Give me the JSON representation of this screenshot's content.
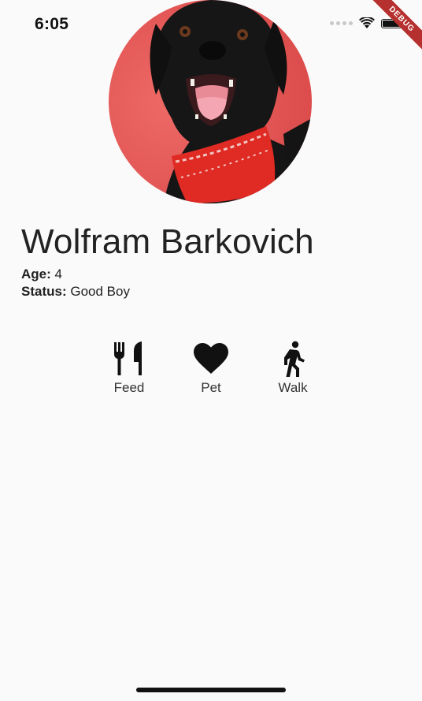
{
  "status_bar": {
    "time": "6:05"
  },
  "debug_banner": {
    "label": "DEBUG"
  },
  "profile": {
    "name": "Wolfram Barkovich",
    "age_label": "Age:",
    "age_value": "4",
    "status_label": "Status:",
    "status_value": "Good Boy"
  },
  "actions": [
    {
      "label": "Feed",
      "icon": "restaurant-icon"
    },
    {
      "label": "Pet",
      "icon": "heart-icon"
    },
    {
      "label": "Walk",
      "icon": "walk-icon"
    }
  ],
  "colors": {
    "background": "#fafafa",
    "text": "#222222",
    "debug_ribbon": "#b5302e",
    "photo_backdrop": "#e85656",
    "bandana": "#e02a24"
  }
}
